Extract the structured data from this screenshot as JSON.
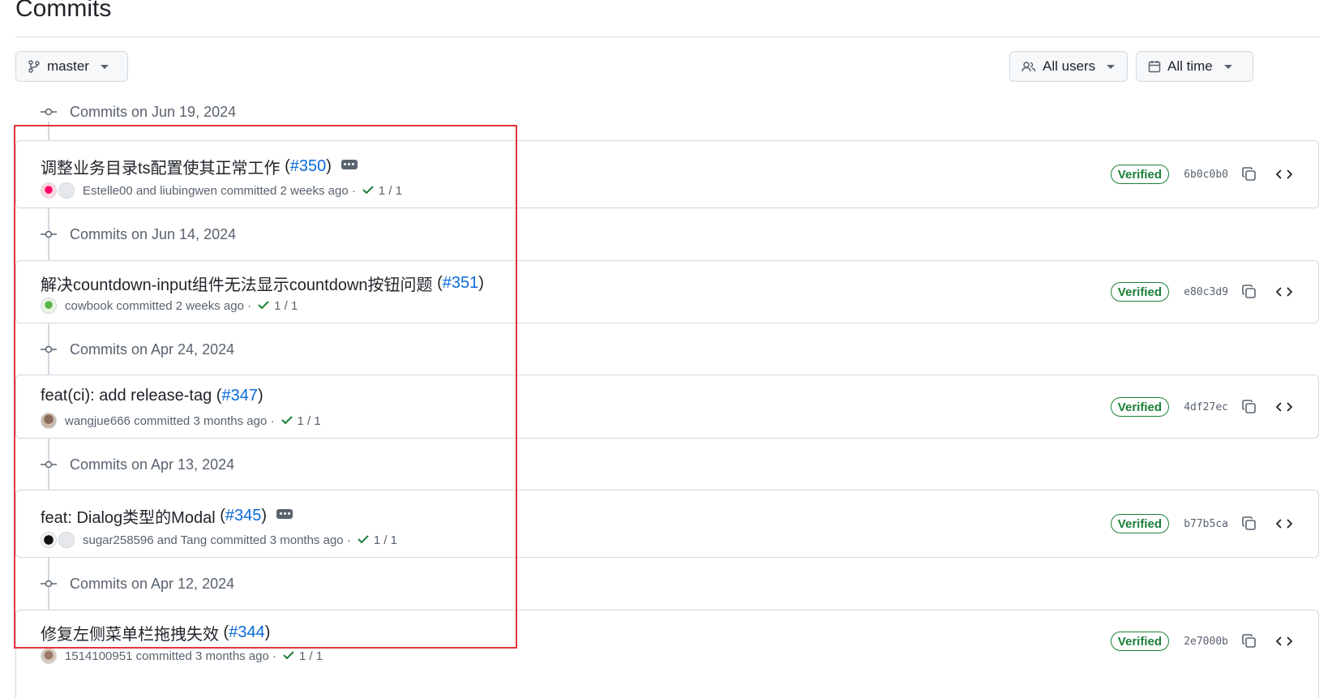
{
  "page": {
    "title": "Commits"
  },
  "toolbar": {
    "branch_label": "master",
    "users_label": "All users",
    "time_label": "All time"
  },
  "colors": {
    "link": "#0969da",
    "verified": "#1a7f37",
    "highlight": "#e5343b"
  },
  "groups": [
    {
      "date_label": "Commits on Jun 19, 2024",
      "commit": {
        "title": "调整业务目录ts配置使其正常工作",
        "pr": "#350",
        "has_more": true,
        "authors": "Estelle00 and liubingwen",
        "action": "committed",
        "time": "2 weeks ago",
        "separator": "·",
        "checks": "1 / 1",
        "verified": "Verified",
        "sha": "6b0c0b0"
      }
    },
    {
      "date_label": "Commits on Jun 14, 2024",
      "commit": {
        "title": "解决countdown-input组件无法显示countdown按钮问题",
        "pr": "#351",
        "has_more": false,
        "authors": "cowbook",
        "action": "committed",
        "time": "2 weeks ago",
        "separator": "·",
        "checks": "1 / 1",
        "verified": "Verified",
        "sha": "e80c3d9"
      }
    },
    {
      "date_label": "Commits on Apr 24, 2024",
      "commit": {
        "title": "feat(ci): add release-tag",
        "pr": "#347",
        "has_more": false,
        "authors": "wangjue666",
        "action": "committed",
        "time": "3 months ago",
        "separator": "·",
        "checks": "1 / 1",
        "verified": "Verified",
        "sha": "4df27ec"
      }
    },
    {
      "date_label": "Commits on Apr 13, 2024",
      "commit": {
        "title": "feat: Dialog类型的Modal",
        "pr": "#345",
        "has_more": true,
        "authors": "sugar258596 and Tang",
        "action": "committed",
        "time": "3 months ago",
        "separator": "·",
        "checks": "1 / 1",
        "verified": "Verified",
        "sha": "b77b5ca"
      }
    },
    {
      "date_label": "Commits on Apr 12, 2024",
      "commit": {
        "title": "修复左侧菜单栏拖拽失效",
        "pr": "#344",
        "has_more": false,
        "authors": "1514100951",
        "action": "committed",
        "time": "3 months ago",
        "separator": "·",
        "checks": "1 / 1",
        "verified": "Verified",
        "sha": "2e7000b"
      }
    }
  ]
}
